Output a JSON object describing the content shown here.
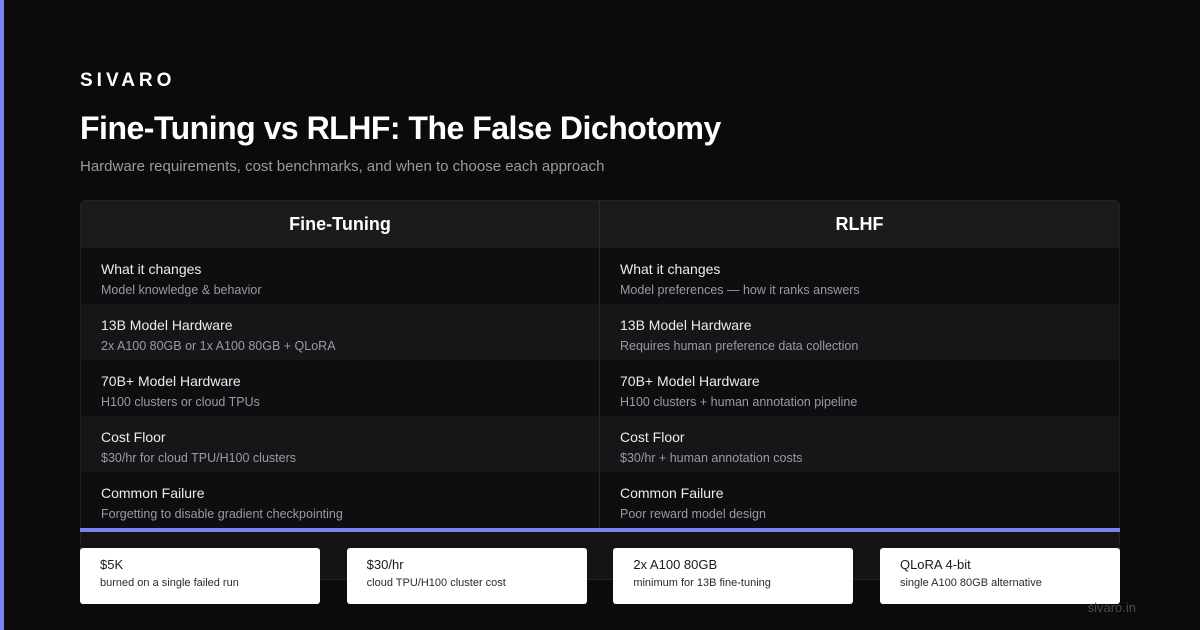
{
  "brand": "SIVARO",
  "title": "Fine-Tuning vs RLHF: The False Dichotomy",
  "subtitle": "Hardware requirements, cost benchmarks, and when to choose each approach",
  "table": {
    "columns": [
      "Fine-Tuning",
      "RLHF"
    ],
    "rows": [
      {
        "left": {
          "label": "What it changes",
          "value": "Model knowledge & behavior"
        },
        "right": {
          "label": "What it changes",
          "value": "Model preferences — how it ranks answers"
        }
      },
      {
        "left": {
          "label": "13B Model Hardware",
          "value": "2x A100 80GB or 1x A100 80GB + QLoRA"
        },
        "right": {
          "label": "13B Model Hardware",
          "value": "Requires human preference data collection"
        }
      },
      {
        "left": {
          "label": "70B+ Model Hardware",
          "value": "H100 clusters or cloud TPUs"
        },
        "right": {
          "label": "70B+ Model Hardware",
          "value": "H100 clusters + human annotation pipeline"
        }
      },
      {
        "left": {
          "label": "Cost Floor",
          "value": "$30/hr for cloud TPU/H100 clusters"
        },
        "right": {
          "label": "Cost Floor",
          "value": "$30/hr + human annotation costs"
        }
      },
      {
        "left": {
          "label": "Common Failure",
          "value": "Forgetting to disable gradient checkpointing"
        },
        "right": {
          "label": "Common Failure",
          "value": "Poor reward model design"
        }
      }
    ]
  },
  "stats": [
    {
      "value": "$5K",
      "label": "burned on a single failed run"
    },
    {
      "value": "$30/hr",
      "label": "cloud TPU/H100 cluster cost"
    },
    {
      "value": "2x A100 80GB",
      "label": "minimum for 13B fine-tuning"
    },
    {
      "value": "QLoRA 4-bit",
      "label": "single A100 80GB alternative"
    }
  ],
  "footer": "sivaro.in",
  "colors": {
    "accent": "#7b83f0",
    "background": "#0b0b0c",
    "card": "#ffffff"
  }
}
